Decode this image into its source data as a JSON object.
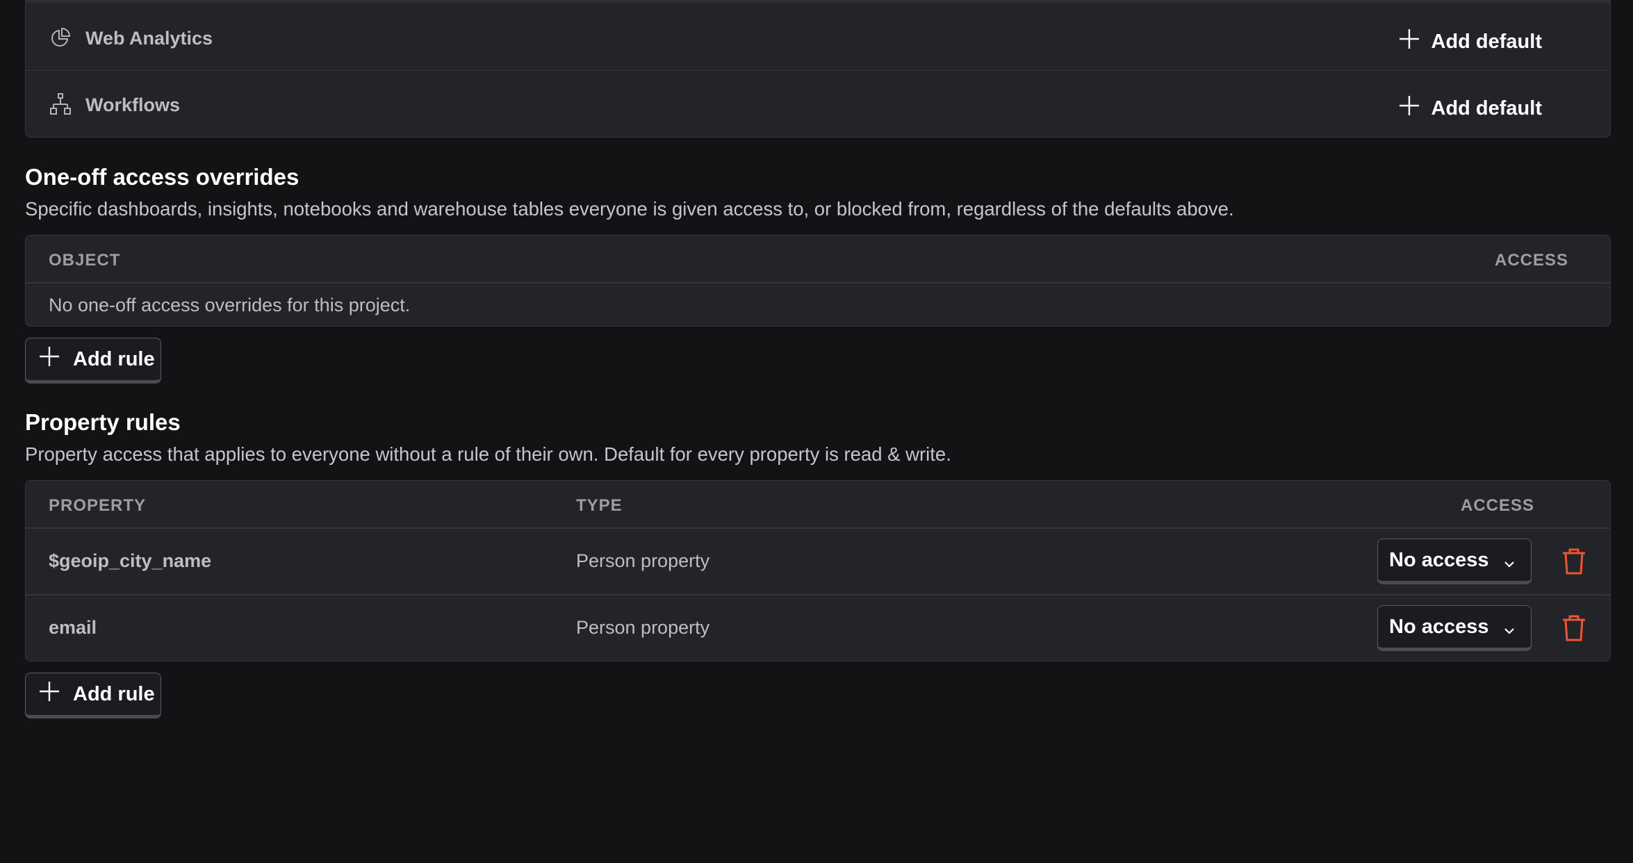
{
  "product_defaults": {
    "rows": [
      {
        "label": "Web Analytics",
        "icon": "pie-chart-icon",
        "action_label": "Add default"
      },
      {
        "label": "Workflows",
        "icon": "workflow-icon",
        "action_label": "Add default"
      }
    ]
  },
  "overrides": {
    "title": "One-off access overrides",
    "description": "Specific dashboards, insights, notebooks and warehouse tables everyone is given access to, or blocked from, regardless of the defaults above.",
    "columns": {
      "object": "OBJECT",
      "access": "ACCESS"
    },
    "empty_text": "No one-off access overrides for this project.",
    "add_rule_label": "Add rule"
  },
  "property_rules": {
    "title": "Property rules",
    "description": "Property access that applies to everyone without a rule of their own. Default for every property is read & write.",
    "columns": {
      "property": "PROPERTY",
      "type": "TYPE",
      "access": "ACCESS"
    },
    "rows": [
      {
        "property": "$geoip_city_name",
        "type": "Person property",
        "access": "No access"
      },
      {
        "property": "email",
        "type": "Person property",
        "access": "No access"
      }
    ],
    "add_rule_label": "Add rule"
  },
  "colors": {
    "background": "#131316",
    "card": "#232429",
    "border": "#34363c",
    "danger": "#f0542f"
  }
}
